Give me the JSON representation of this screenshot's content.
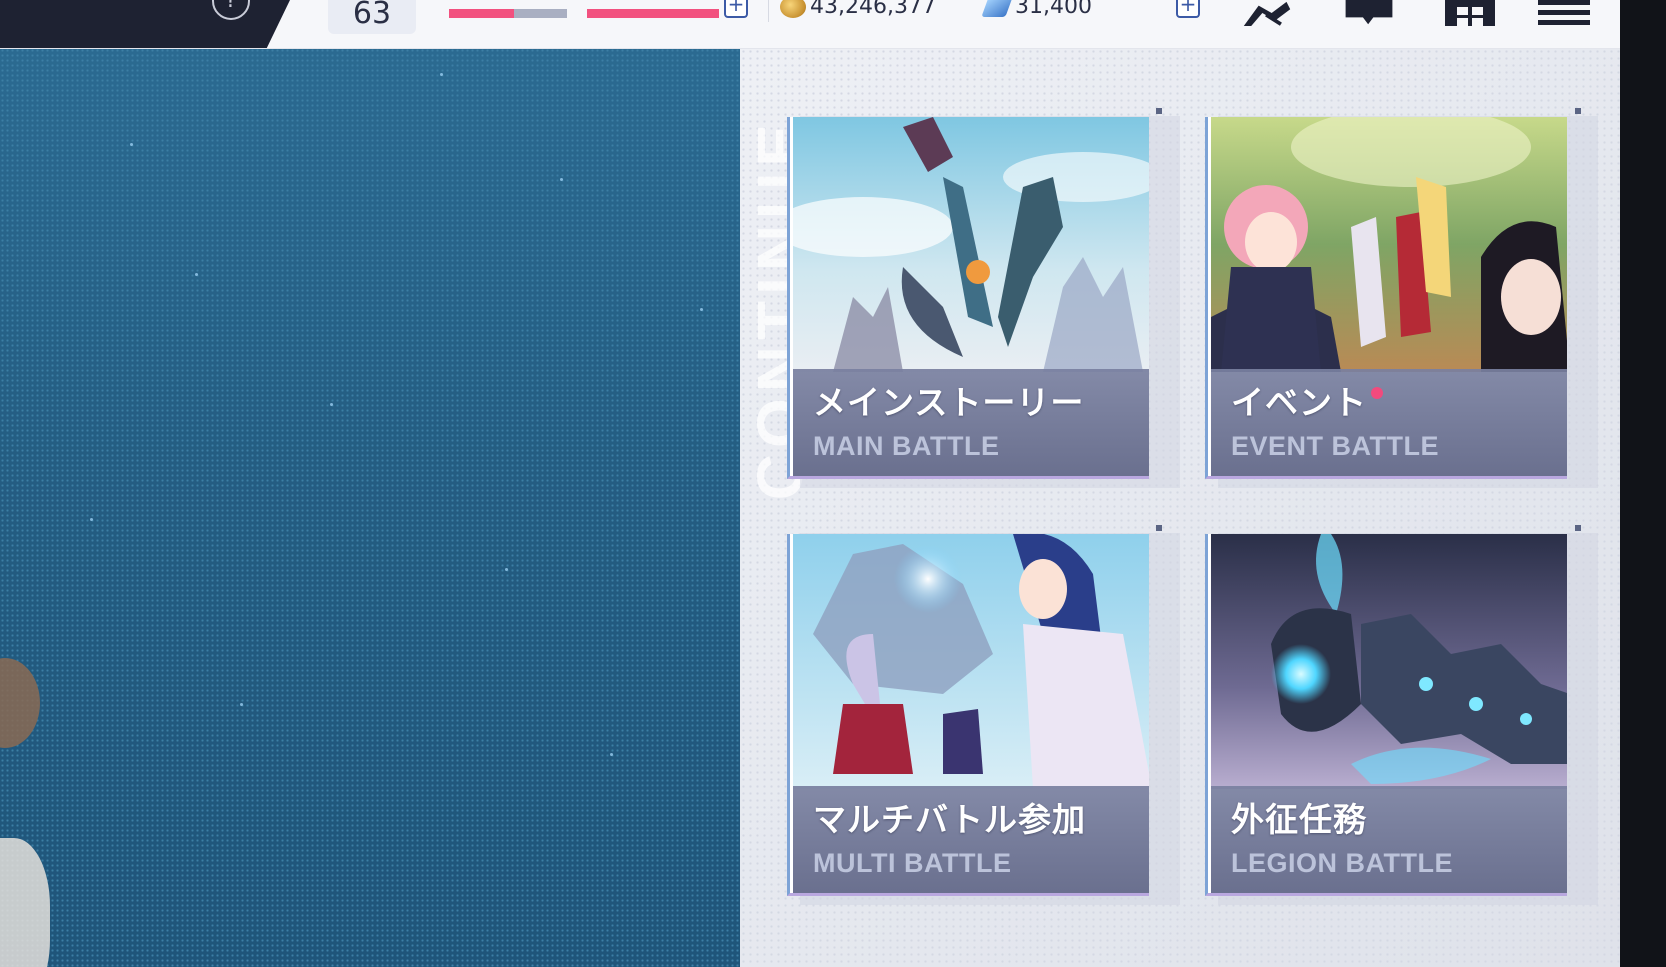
{
  "header": {
    "level": "63",
    "exp_progress": 0.55,
    "stamina_progress": 1.0,
    "gold": "43,246,377",
    "gems": "31,400",
    "help_symbol": "?",
    "add_symbol": "+",
    "icons": [
      "help-icon",
      "gold-coin-icon",
      "gem-icon",
      "formation-icon",
      "chat-icon",
      "grid-menu-icon",
      "hamburger-menu-icon"
    ]
  },
  "side_word": "CONTINUE",
  "battles": [
    {
      "title": "メインストーリー",
      "subtitle": "MAIN BATTLE",
      "notify": false
    },
    {
      "title": "イベント",
      "subtitle": "EVENT BATTLE",
      "notify": true
    },
    {
      "title": "マルチバトル参加",
      "subtitle": "MULTI BATTLE",
      "notify": false
    },
    {
      "title": "外征任務",
      "subtitle": "LEGION BATTLE",
      "notify": false
    }
  ],
  "colors": {
    "accent_pink": "#f24a7d",
    "panel_blue": "#245d82",
    "label_overlay": "#6a7090",
    "plus_blue": "#3c5aa6"
  }
}
